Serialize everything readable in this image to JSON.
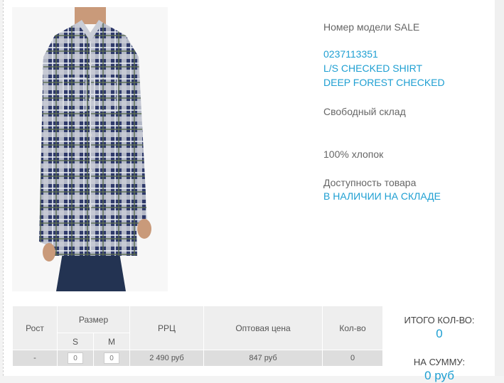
{
  "product": {
    "model_line": "Номер модели SALE",
    "sku": "0237113351",
    "name": "L/S CHECKED SHIRT",
    "color": "DEEP FOREST CHECKED",
    "warehouse": "Свободный склад",
    "material": "100% хлопок",
    "availability_label": "Доступность товара",
    "availability_value": "В НАЛИЧИИ НА СКЛАДЕ"
  },
  "table": {
    "headers": {
      "height": "Рост",
      "size": "Размер",
      "size_s": "S",
      "size_m": "M",
      "rrp": "РРЦ",
      "wholesale": "Оптовая цена",
      "qty": "Кол-во"
    },
    "row": {
      "height": "-",
      "size_s_value": "0",
      "size_m_value": "0",
      "rrp": "2 490 руб",
      "wholesale": "847 руб",
      "qty": "0"
    }
  },
  "summary": {
    "total_qty_label": "ИТОГО КОЛ-ВО:",
    "total_qty_value": "0",
    "sum_label": "НА СУММУ:",
    "sum_value": "0 руб"
  },
  "colors": {
    "accent": "#1e9fd2",
    "header_bg": "#eeeeee",
    "row_bg": "#dddddd"
  }
}
